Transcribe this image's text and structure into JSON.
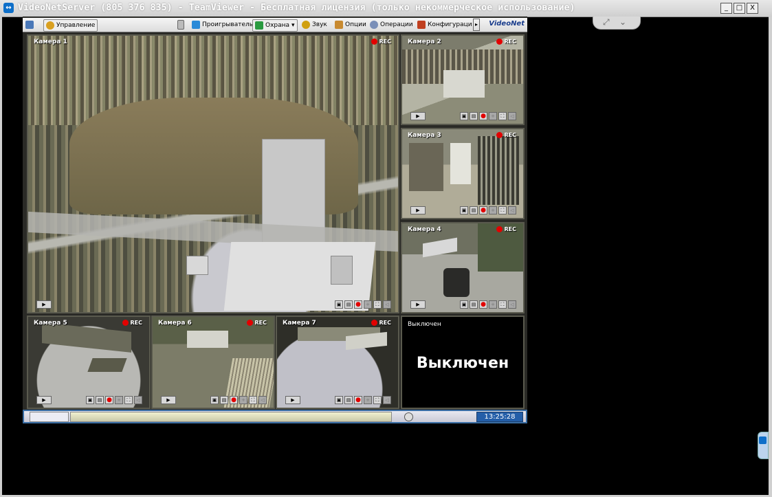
{
  "window": {
    "title": "VideoNetServer (805 376 835) - TeamViewer - Бесплатная лицензия (только некоммерческое использование)",
    "buttons": [
      "_",
      "□",
      "X"
    ]
  },
  "toolbar": {
    "control_label": "Управление",
    "player_label": "Проигрыватель",
    "security_label": "Охрана",
    "sound_label": "Звук",
    "options_label": "Опции",
    "operations_label": "Операции",
    "config_label": "Конфигураци",
    "logo": "VideoNet"
  },
  "cameras": [
    {
      "label": "Камера 1",
      "rec": "REC"
    },
    {
      "label": "Камера 2",
      "rec": "REC"
    },
    {
      "label": "Камера 3",
      "rec": "REC"
    },
    {
      "label": "Камера 4",
      "rec": "REC"
    },
    {
      "label": "Камера 5",
      "rec": "REC"
    },
    {
      "label": "Камера 6",
      "rec": "REC"
    },
    {
      "label": "Камера 7",
      "rec": "REC"
    }
  ],
  "disabled_cell": {
    "small_label": "Выключен",
    "big_label": "Выключен"
  },
  "status": {
    "time": "13:25:28"
  },
  "colors": {
    "rec": "#e20000",
    "time_bg": "#245ea8",
    "accent": "#0e6fc9"
  }
}
